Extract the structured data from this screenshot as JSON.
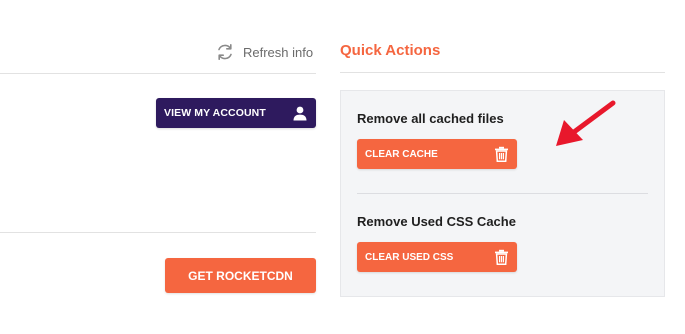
{
  "toolbar": {
    "refresh_label": "Refresh info",
    "refresh_icon": "refresh-icon"
  },
  "account": {
    "view_label": "VIEW MY ACCOUNT",
    "icon": "user-icon"
  },
  "cdn": {
    "get_label": "GET ROCKETCDN"
  },
  "quick_actions": {
    "title": "Quick Actions",
    "actions": [
      {
        "title": "Remove all cached files",
        "button_label": "CLEAR CACHE",
        "icon": "trash-icon"
      },
      {
        "title": "Remove Used CSS Cache",
        "button_label": "CLEAR USED CSS",
        "icon": "trash-icon"
      }
    ]
  },
  "colors": {
    "accent": "#f56640",
    "account_button": "#2e1a5e",
    "annotation_arrow": "#e8182c",
    "panel_bg": "#f4f5f7"
  }
}
